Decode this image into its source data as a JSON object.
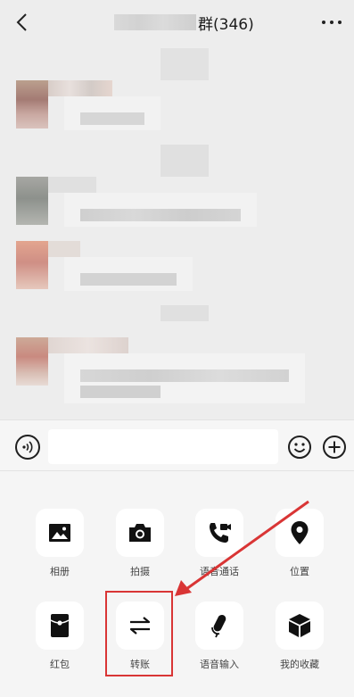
{
  "header": {
    "title": "群(346)"
  },
  "icons": {
    "back": "chevron-left-icon",
    "more": "more-dots-icon",
    "voice": "voice-icon",
    "emoji": "emoji-icon",
    "plus": "plus-icon"
  },
  "input": {
    "placeholder": ""
  },
  "panel": {
    "row1": [
      {
        "label": "相册",
        "icon": "image-icon"
      },
      {
        "label": "拍摄",
        "icon": "camera-icon"
      },
      {
        "label": "语音通话",
        "icon": "video-call-icon"
      },
      {
        "label": "位置",
        "icon": "location-pin-icon"
      }
    ],
    "row2": [
      {
        "label": "红包",
        "icon": "red-packet-icon"
      },
      {
        "label": "转账",
        "icon": "transfer-icon"
      },
      {
        "label": "语音输入",
        "icon": "microphone-icon"
      },
      {
        "label": "我的收藏",
        "icon": "favorites-box-icon"
      }
    ]
  },
  "colors": {
    "background": "#ededed",
    "panel": "#f5f5f5",
    "annotation": "#d93535"
  }
}
